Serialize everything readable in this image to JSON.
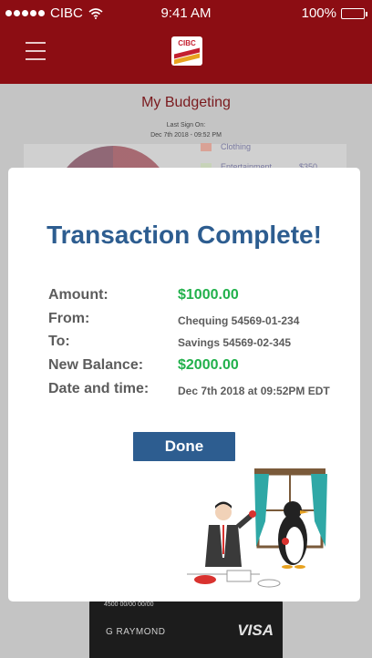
{
  "status_bar": {
    "carrier": "CIBC",
    "time": "9:41 AM",
    "battery": "100%",
    "icons": [
      "signal-dots-icon",
      "wifi-icon",
      "battery-icon"
    ]
  },
  "nav": {
    "logo_text": "CIBC",
    "menu_icon": "hamburger-icon"
  },
  "page": {
    "title": "My Budgeting",
    "last_sign_on_label": "Last Sign On:",
    "last_sign_on_value": "Dec 7th 2018 - 09:52 PM",
    "legend": [
      {
        "label": "Clothing",
        "color": "#d9a296"
      },
      {
        "label": "Entertainment",
        "color": "#c7d3b8",
        "value": "$350"
      }
    ]
  },
  "modal": {
    "title": "Transaction Complete!",
    "rows": [
      {
        "label": "Amount:",
        "value": "$1000.00"
      },
      {
        "label": "From:",
        "value": "Chequing 54569-01-234"
      },
      {
        "label": "To:",
        "value": "Savings 54569-02-345"
      },
      {
        "label": "New Balance:",
        "value": "$2000.00"
      },
      {
        "label": "Date and time:",
        "value": "Dec 7th 2018 at 09:52PM EDT"
      }
    ],
    "done_label": "Done"
  },
  "card": {
    "number_fragment": "4500   00/00   00/00",
    "name": "G RAYMOND",
    "brand": "VISA"
  },
  "colors": {
    "brand_red": "#8c0d13",
    "title_blue": "#2d5d90",
    "amount_green": "#22b14c"
  }
}
